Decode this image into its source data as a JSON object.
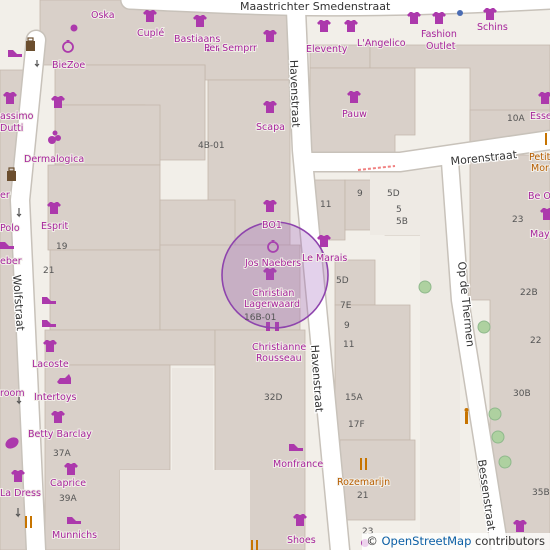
{
  "streets": {
    "maastrichter": "Maastrichter Smedenstraat",
    "havenstraat_top": "Havenstraat",
    "havenstraat_bottom": "Havenstraat",
    "morenstraat": "Morenstraat",
    "wolfstraat": "Wolfstraat",
    "op_de_thermen": "Op de Thermen",
    "bessenstraat": "Bessenstraat"
  },
  "shops": {
    "oska": "Oska",
    "cuple": "Cuplé",
    "bastiaans": "Bastiaans",
    "per_semprr": "Per Semprr",
    "eleventy": "Eleventy",
    "langelico": "L'Angelico",
    "fashion": "Fashion",
    "outlet": "Outlet",
    "schins": "Schins",
    "biezoe": "BieZoe",
    "assimo": "assimo",
    "dutti": "Dutti",
    "pauw": "Pauw",
    "scapa": "Scapa",
    "dermalogica": "Dermalogica",
    "petite": "Petit",
    "mor": "Mor",
    "be_or": "Be Or",
    "maym": "Mayr",
    "er": "er",
    "esprit": "Esprit",
    "polo": "Polo",
    "aeber": "eber",
    "bo1": "BO1",
    "jos_naebers": "Jos Naebers",
    "le_marais": "Le Marais",
    "christian": "Christian",
    "lagerwaard": "Lagerwaard",
    "lacoste": "Lacoste",
    "christianne": "Christianne",
    "rousseau": "Rousseau",
    "room": "room",
    "intertoys": "Intertoys",
    "betty_barclay": "Betty Barclay",
    "monfrance": "Monfrance",
    "rozemarijn": "Rozemarijn",
    "caprice": "Caprice",
    "la_dress": "La Dress",
    "munnichs": "Munnichs",
    "shoes": "Shoes",
    "esse": "Esse"
  },
  "house_numbers": {
    "n4b01": "4B-01",
    "n10a": "10A",
    "n19": "19",
    "n21": "21",
    "n11": "11",
    "n9a": "9",
    "n5d": "5D",
    "n5": "5",
    "n5b": "5B",
    "n23": "23",
    "n22b": "22B",
    "n5d2": "5D",
    "n7e": "7E",
    "n9": "9",
    "n11b": "11",
    "n16b01": "16B-01",
    "n22": "22",
    "n30b": "30B",
    "n32d": "32D",
    "n15a": "15A",
    "n17f": "17F",
    "n37a": "37A",
    "n39a": "39A",
    "n21b": "21",
    "n35b": "35B",
    "n23b": "23"
  },
  "attribution": {
    "prefix": "© ",
    "link": "OpenStreetMap",
    "suffix": " contributors"
  },
  "colors": {
    "land": "#f2efe9",
    "building": "#d9d0c9",
    "building_outline": "#c4b6ab",
    "road": "#ffffff",
    "road_casing": "#c8c2ba",
    "shop_purple": "#ac39ac",
    "food_orange": "#c77400",
    "marker_fill": "#9b59b6",
    "marker_stroke": "#8e44ad",
    "tree_green": "#aed1a0"
  }
}
